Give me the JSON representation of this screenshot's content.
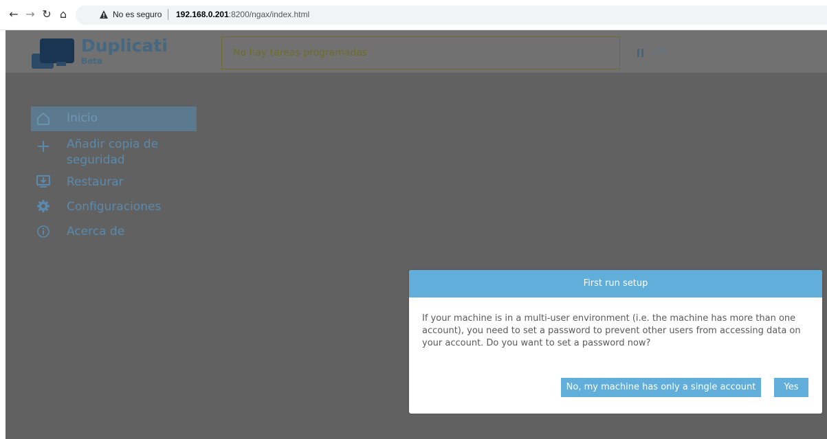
{
  "browser": {
    "security_label": "No es seguro",
    "url_host": "192.168.0.201",
    "url_rest": ":8200/ngax/index.html"
  },
  "app": {
    "brand": "Duplicati",
    "brand_sub": "Beta",
    "status_text": "No hay tareas programadas"
  },
  "sidebar": {
    "items": [
      {
        "label": "Inicio",
        "icon": "home-icon",
        "active": true
      },
      {
        "label": "Añadir copia de seguridad",
        "icon": "plus-icon",
        "active": false
      },
      {
        "label": "Restaurar",
        "icon": "restore-icon",
        "active": false
      },
      {
        "label": "Configuraciones",
        "icon": "gear-icon",
        "active": false
      },
      {
        "label": "Acerca de",
        "icon": "info-icon",
        "active": false
      }
    ]
  },
  "dialog": {
    "title": "First run setup",
    "message": "If your machine is in a multi-user environment (i.e. the machine has more than one account), you need to set a password to prevent other users from accessing data on your account. Do you want to set a password now?",
    "no_label": "No, my machine has only a single account",
    "yes_label": "Yes"
  },
  "colors": {
    "accent": "#62aedb",
    "brand": "#45677f",
    "sidebar_text": "#5a8aad",
    "background": "#616161"
  }
}
